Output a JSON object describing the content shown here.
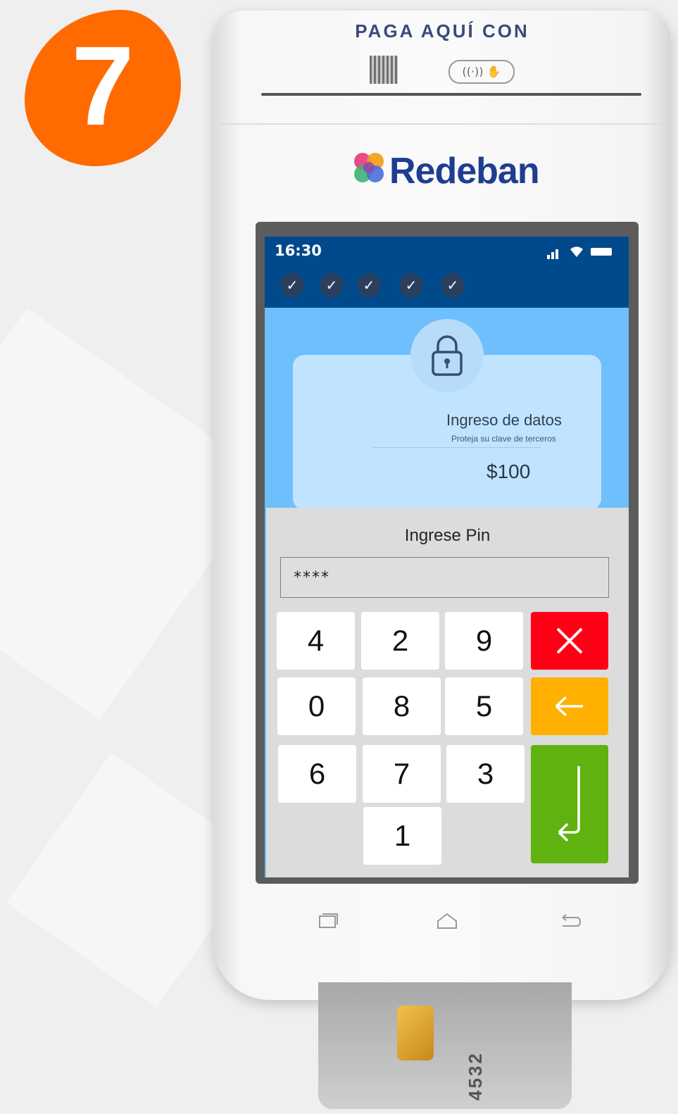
{
  "step": {
    "number": "7",
    "color": "#ff6b00"
  },
  "device": {
    "printer_label": "PAGA AQUÍ CON",
    "brand": "Redeban",
    "brand_color": "#1f3d92",
    "nav": {
      "recent": "recent-apps-icon",
      "home": "home-icon",
      "back": "back-icon"
    }
  },
  "status_bar": {
    "time": "16:30",
    "icons": [
      "signal-icon",
      "wifi-icon",
      "battery-icon"
    ],
    "progress_steps_completed": 5,
    "progress_steps_total": 5,
    "background": "#004a8c"
  },
  "info_card": {
    "icon": "lock-icon",
    "title": "Ingreso de datos",
    "subtitle": "Proteja su clave de terceros",
    "amount": "$100"
  },
  "pin_pad": {
    "title": "Ingrese Pin",
    "value": "****",
    "keys": [
      "4",
      "2",
      "9",
      "0",
      "8",
      "5",
      "6",
      "7",
      "3",
      "1"
    ],
    "cancel": {
      "icon": "close-icon",
      "color": "#ff0016"
    },
    "clear": {
      "icon": "arrow-left-icon",
      "color": "#ffb000"
    },
    "enter": {
      "icon": "enter-icon",
      "color": "#5fb20f"
    }
  },
  "card": {
    "digits": "4532"
  }
}
